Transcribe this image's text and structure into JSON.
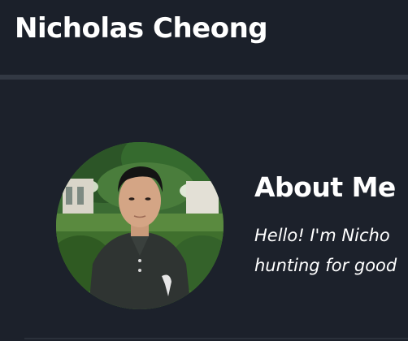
{
  "header": {
    "title": "Nicholas Cheong"
  },
  "about": {
    "heading": "About Me",
    "text_lines": [
      "Hello! I'm Nicho",
      "hunting for good"
    ],
    "photo_icon": "profile-photo"
  },
  "colors": {
    "background": "#1c212b",
    "header_background": "#1b202a",
    "divider": "#323843",
    "text": "#ffffff"
  }
}
